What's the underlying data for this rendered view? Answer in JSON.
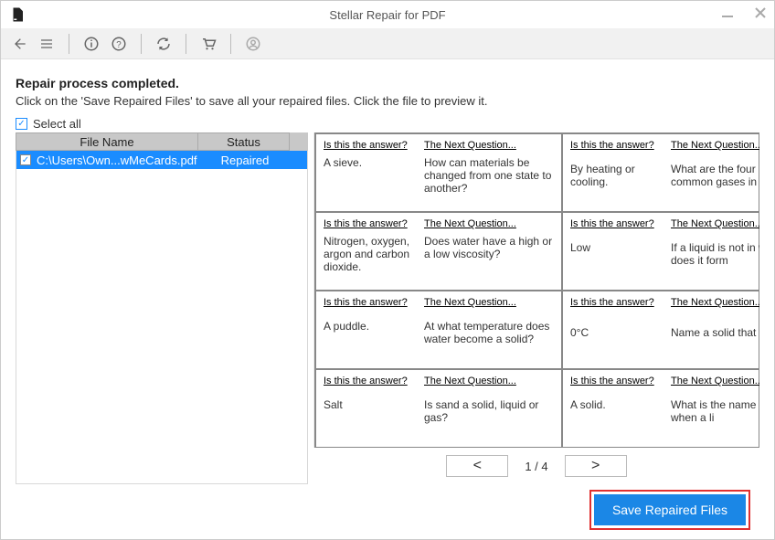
{
  "app_title": "Stellar Repair for PDF",
  "heading": "Repair process completed.",
  "subtext": "Click on the 'Save Repaired Files' to save all your repaired files. Click the file to preview it.",
  "select_all_label": "Select all",
  "table": {
    "col_name": "File Name",
    "col_status": "Status",
    "rows": [
      {
        "checked": true,
        "name": "C:\\Users\\Own...wMeCards.pdf",
        "status": "Repaired"
      }
    ]
  },
  "preview": {
    "answer_header": "Is this the answer?",
    "question_header": "The Next Question...",
    "cards": [
      {
        "answer": "A sieve.",
        "question": "How can materials be changed from one state to another?"
      },
      {
        "answer": "By heating or cooling.",
        "question": "What are the four common gases in"
      },
      {
        "answer": "Nitrogen, oxygen, argon and carbon dioxide.",
        "question": "Does water have a high or a low viscosity?"
      },
      {
        "answer": "Low",
        "question": "If a liquid is not in what does it form"
      },
      {
        "answer": "A puddle.",
        "question": "At what temperature does water become a solid?"
      },
      {
        "answer": "0°C",
        "question": "Name a solid that poured."
      },
      {
        "answer": "Salt",
        "question": "Is sand a solid, liquid or gas?"
      },
      {
        "answer": "A solid.",
        "question": "What is the name process when a li"
      }
    ]
  },
  "pager": {
    "prev": "<",
    "next": ">",
    "current_page": 1,
    "total_pages": 4,
    "counter": "1 / 4"
  },
  "save_button": "Save Repaired Files"
}
